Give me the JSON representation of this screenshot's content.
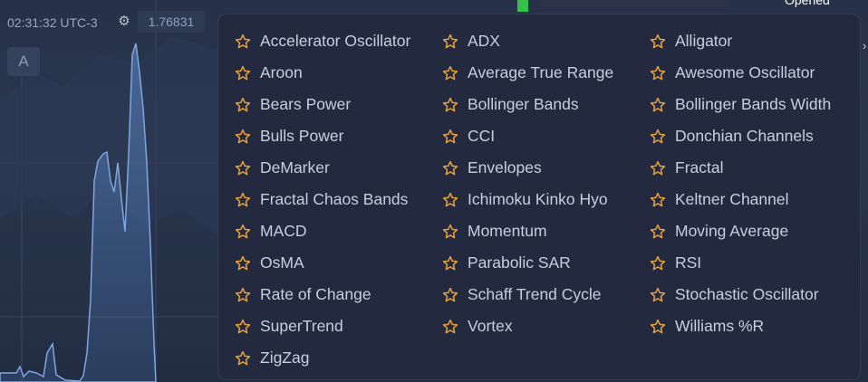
{
  "colors": {
    "star": "#e9a23b",
    "item_text": "#c6cede",
    "panel_bg": "#232a3f",
    "chart_line": "#6f9ad6",
    "green_marker": "#35c24a"
  },
  "chart_header": {
    "time": "02:31:32 UTC-3",
    "settings_icon": "gear-icon",
    "price": "1.76831",
    "asset_button": "A"
  },
  "top_right": {
    "status": "Opened"
  },
  "indicators": {
    "star_icon": "star-outline-icon",
    "items": [
      "Accelerator Oscillator",
      "ADX",
      "Alligator",
      "Aroon",
      "Average True Range",
      "Awesome Oscillator",
      "Bears Power",
      "Bollinger Bands",
      "Bollinger Bands Width",
      "Bulls Power",
      "CCI",
      "Donchian Channels",
      "DeMarker",
      "Envelopes",
      "Fractal",
      "Fractal Chaos Bands",
      "Ichimoku Kinko Hyo",
      "Keltner Channel",
      "MACD",
      "Momentum",
      "Moving Average",
      "OsMA",
      "Parabolic SAR",
      "RSI",
      "Rate of Change",
      "Schaff Trend Cycle",
      "Stochastic Oscillator",
      "SuperTrend",
      "Vortex",
      "Williams %R",
      "ZigZag"
    ]
  }
}
